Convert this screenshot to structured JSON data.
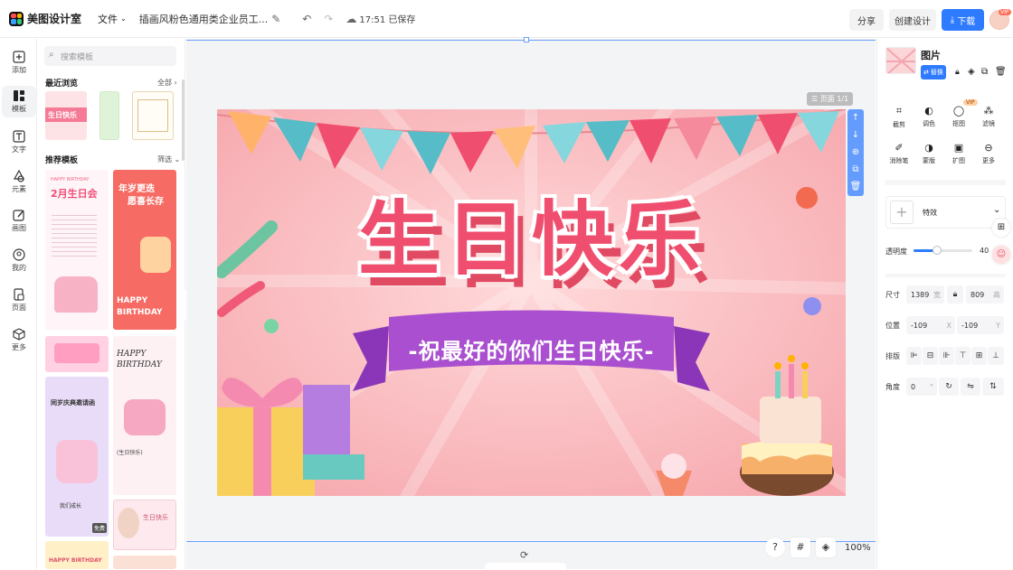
{
  "topbar": {
    "app_name": "美图设计室",
    "file_menu": "文件",
    "doc_title": "插画风粉色通用类企业员工...",
    "save_status": "17:51 已保存",
    "share_label": "分享",
    "create_label": "创建设计",
    "download_label": "下载",
    "vip": "VIP"
  },
  "leftnav": {
    "items": [
      {
        "label": "添加",
        "icon": "plus-square-icon"
      },
      {
        "label": "模板",
        "icon": "template-icon"
      },
      {
        "label": "文字",
        "icon": "text-icon"
      },
      {
        "label": "元素",
        "icon": "shapes-icon"
      },
      {
        "label": "画图",
        "icon": "pen-icon"
      },
      {
        "label": "我的",
        "icon": "user-icon"
      },
      {
        "label": "页面",
        "icon": "page-icon"
      },
      {
        "label": "更多",
        "icon": "box-icon"
      }
    ]
  },
  "panel": {
    "search_placeholder": "搜索模板",
    "recent_title": "最近浏览",
    "all_label": "全部",
    "recommend_title": "推荐模板",
    "filter_label": "筛选",
    "recent_text": "生日快乐",
    "cards": {
      "c1_line1": "HAPPY BIRTHDAY",
      "c1_line2": "2月生日会",
      "c2_line1": "年岁更迭",
      "c2_line2": "愿喜长存",
      "c2_line3": "HAPPY",
      "c2_line4": "BIRTHDAY",
      "c4_text": "HAPPY BIRTHDAY",
      "c5_line1": "同岁庆典邀请函",
      "c5_line2": "我们成长",
      "c6_label": "(生日快乐)",
      "c7_text": "生日快乐",
      "c8_text": "HAPPY BIRTHDAY",
      "free_badge": "免费"
    }
  },
  "canvas": {
    "page_label": "页面 1/1",
    "poster_title": "生日快乐",
    "poster_subtitle": "-祝最好的你们生日快乐-",
    "zoom": "100%",
    "colors": {
      "bg": "#f8b3b8",
      "title": "#f04e6e",
      "ribbon": "#a24bc9"
    }
  },
  "rpanel": {
    "title": "图片",
    "replace_label": "替换",
    "tools": [
      "截剪",
      "调色",
      "抠图",
      "滤镜",
      "消除笔",
      "蒙版",
      "扩图",
      "更多"
    ],
    "vip": "VIP",
    "effect_label": "特效",
    "opacity_label": "透明度",
    "opacity_value": "40",
    "opacity_fraction": 0.4,
    "size_label": "尺寸",
    "width": "1389",
    "width_unit": "宽",
    "height": "809",
    "height_unit": "高",
    "pos_label": "位置",
    "x": "-109",
    "x_unit": "X",
    "y": "-109",
    "y_unit": "Y",
    "arrange_label": "排版",
    "angle_label": "角度",
    "angle": "0",
    "angle_unit": "°"
  }
}
